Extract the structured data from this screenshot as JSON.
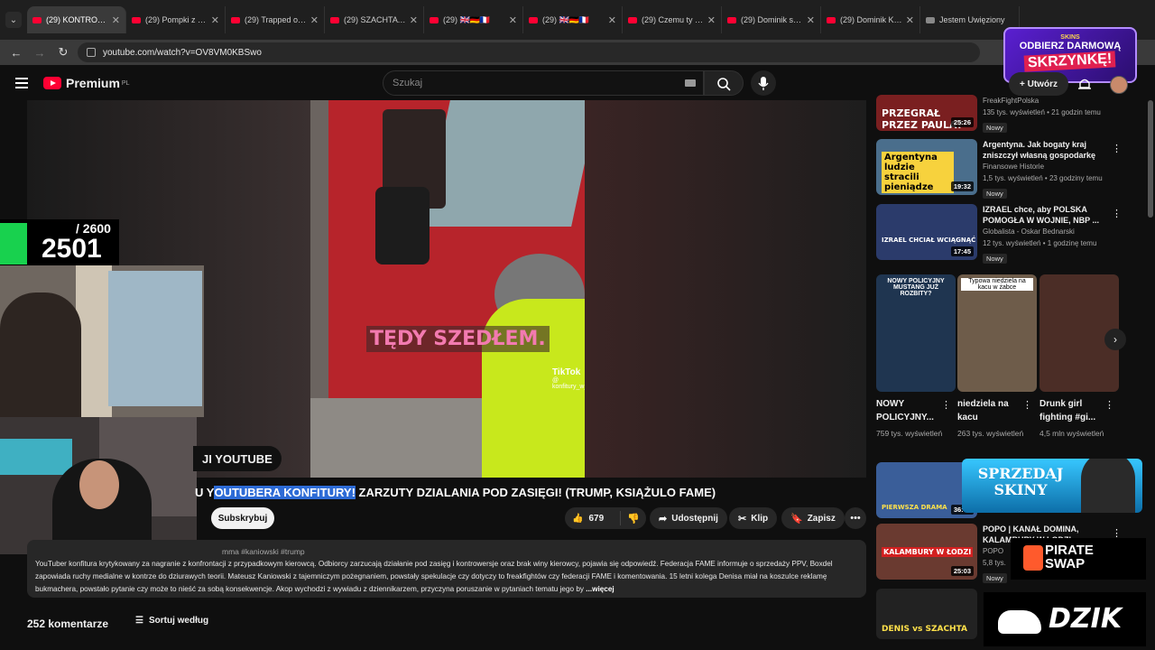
{
  "browser": {
    "tabs": [
      {
        "label": "(29) KONTROWER",
        "active": true
      },
      {
        "label": "(29) Pompki z drz"
      },
      {
        "label": "(29) Trapped on E"
      },
      {
        "label": "(29) SZACHTA MC"
      },
      {
        "label": "(29) 🇬🇧🇩🇪🇫🇷"
      },
      {
        "label": "(29) 🇬🇧🇩🇪🇫🇷"
      },
      {
        "label": "(29) Czemu ty mó"
      },
      {
        "label": "(29) Dominik staw"
      },
      {
        "label": "(29) Dominik Kons"
      },
      {
        "label": "Jestem Uwięziony"
      }
    ],
    "url": "youtube.com/watch?v=OV8VM0KBSwo"
  },
  "overlay_promo": {
    "brand": "SKINS",
    "line1": "ODBIERZ DARMOWĄ",
    "line2": "SKRZYNKĘ!"
  },
  "header": {
    "logo_text": "Premium",
    "region": "PL",
    "search_placeholder": "Szukaj",
    "create_label": "+ Utwórz"
  },
  "stream_overlay": {
    "goal_total": "/ 2600",
    "goal_current": "2501"
  },
  "video": {
    "overlay_caption": "TĘDY SZEDŁEM.",
    "tiktok_label": "TikTok",
    "tiktok_handle": "@ konfitury_w_akcji",
    "chip_text": "JI YOUTUBE",
    "title_prefix": "U Y",
    "title_highlight": "OUTUBERA KONFITURY!",
    "title_rest": " ZARZUTY DZIALANIA POD ZASIĘGI! (TRUMP, KSIĄŻULO FAME)"
  },
  "actions": {
    "subscribe": "Subskrybuj",
    "likes": "679",
    "share": "Udostępnij",
    "clip": "Klip",
    "save": "Zapisz"
  },
  "description": {
    "tags": "mma #kaniowski #trump",
    "body": "YouTuber konfitura krytykowany za nagranie z konfrontacji z przypadkowym kierowcą. Odbiorcy zarzucają działanie pod zasięg i kontrowersje oraz brak winy kierowcy, pojawia się odpowiedź. Federacja FAME informuje o sprzedaży PPV, Boxdel zapowiada ruchy medialne w kontrze do dziurawych teorii. Mateusz Kaniowski z tajemniczym pożegnaniem, powstały spekulacje czy dotyczy to freakfightów czy federacji FAME i komentowania. 15 letni kolega Denisa miał na koszulce reklamę bukmachera, powstało pytanie czy może to nieść za sobą konsekwencje. Akop wychodzi z wywiadu z dziennikarzem, przyczyna poruszanie w pytaniach tematu jego by",
    "more": "...więcej"
  },
  "comments": {
    "count_label": "252 komentarze",
    "sort_label": "Sortuj według"
  },
  "sidebar": {
    "videos": [
      {
        "thumb_text": "PRZEGRAŁ PRZEZ PAULA?",
        "duration": "25:26",
        "title": "",
        "channel": "FreakFightPolska",
        "stats": "135 tys. wyświetleń • 21 godzin temu",
        "badge": "Nowy"
      },
      {
        "thumb_text": "Argentyna ludzie stracili pieniądze",
        "duration": "19:32",
        "title": "Argentyna. Jak bogaty kraj zniszczył własną gospodarkę",
        "channel": "Finansowe Historie",
        "stats": "1,5 tys. wyświetleń • 23 godziny temu",
        "badge": "Nowy"
      },
      {
        "thumb_text": "IZRAEL CHCIAŁ WCIĄGNĄĆ",
        "duration": "17:45",
        "title": "IZRAEL chce, aby POLSKA POMOGŁA W WOJNIE, NBP ...",
        "channel": "Globalista - Oskar Bednarski",
        "stats": "12 tys. wyświetleń • 1 godzinę temu",
        "badge": "Nowy"
      },
      {
        "thumb_text": "PIERWSZA DRAMA",
        "duration": "36:07",
        "title": "",
        "channel": "",
        "stats": "",
        "badge": ""
      },
      {
        "thumb_text": "KALAMBURY W ŁODZI",
        "duration": "25:03",
        "title": "POPO | KANAŁ DOMINA, KALAMBURY W ŁODZI",
        "channel": "POPO",
        "stats": "5,8 tys.",
        "badge": "Nowy"
      },
      {
        "thumb_text": "DENIS vs SZACHTA",
        "duration": "",
        "title": "",
        "channel": "",
        "stats": "",
        "badge": ""
      }
    ],
    "shorts": [
      {
        "caption": "NOWY POLICYJNY MUSTANG JUŻ ROZBITY?",
        "title": "NOWY POLICYJNY...",
        "views": "759 tys. wyświetleń"
      },
      {
        "caption": "Typowa niedziela na kacu w żabce",
        "title": "niedziela na kacu",
        "views": "263 tys. wyświetleń"
      },
      {
        "caption": "",
        "title": "Drunk girl fighting #gi...",
        "views": "4,5 mln wyświetleń"
      }
    ]
  },
  "ads": {
    "sell_skins": "SPRZEDAJ SKINY",
    "pirate_swap": "PIRATE SWAP",
    "dzik": "DZIK"
  },
  "colors": {
    "accent": "#ff0033",
    "highlight": "#2d6bd6",
    "neon": "#c8e81c"
  }
}
